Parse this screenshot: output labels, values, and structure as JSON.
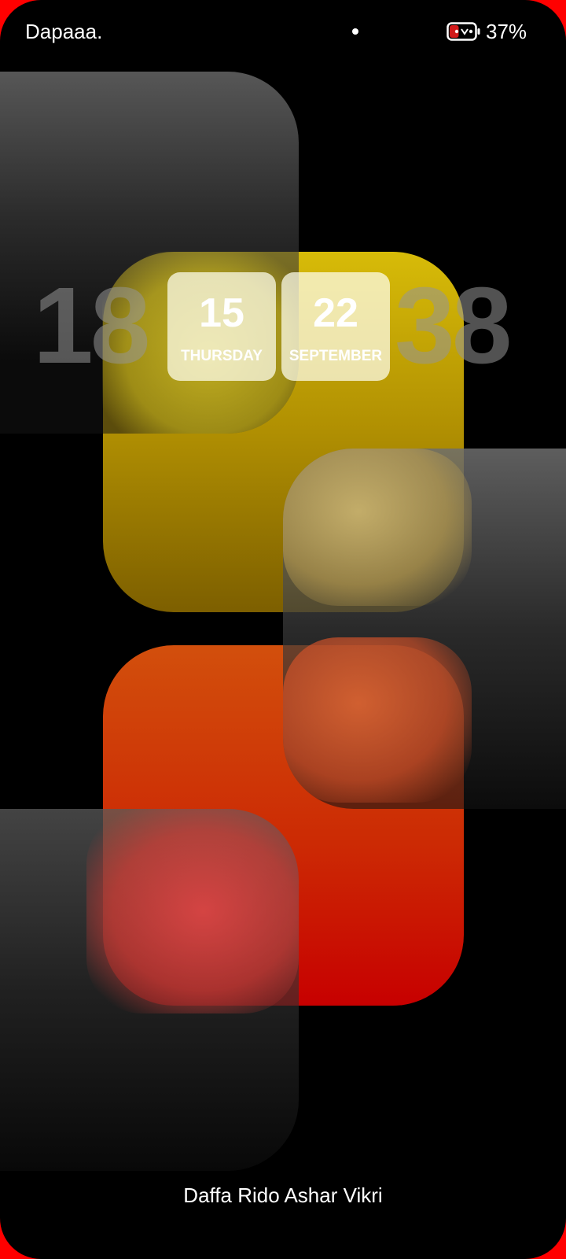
{
  "status_bar": {
    "carrier": "Dapaaa.",
    "battery_percent": "37%",
    "battery_level": 0.37
  },
  "clock": {
    "hour": "18",
    "minute": "38"
  },
  "date": {
    "day_number": "15",
    "weekday": "THURSDAY",
    "month_number": "22",
    "month_name": "SEPTEMBER"
  },
  "owner_info": "Daffa Rido Ashar Vikri",
  "colors": {
    "frame": "#ff0000",
    "background": "#000000",
    "yellow_tile": "#c4a405",
    "red_tile": "#cc2a04",
    "date_card": "#f2ecd0"
  },
  "icons": {
    "notification": "dot-icon",
    "battery": "battery-icon"
  }
}
